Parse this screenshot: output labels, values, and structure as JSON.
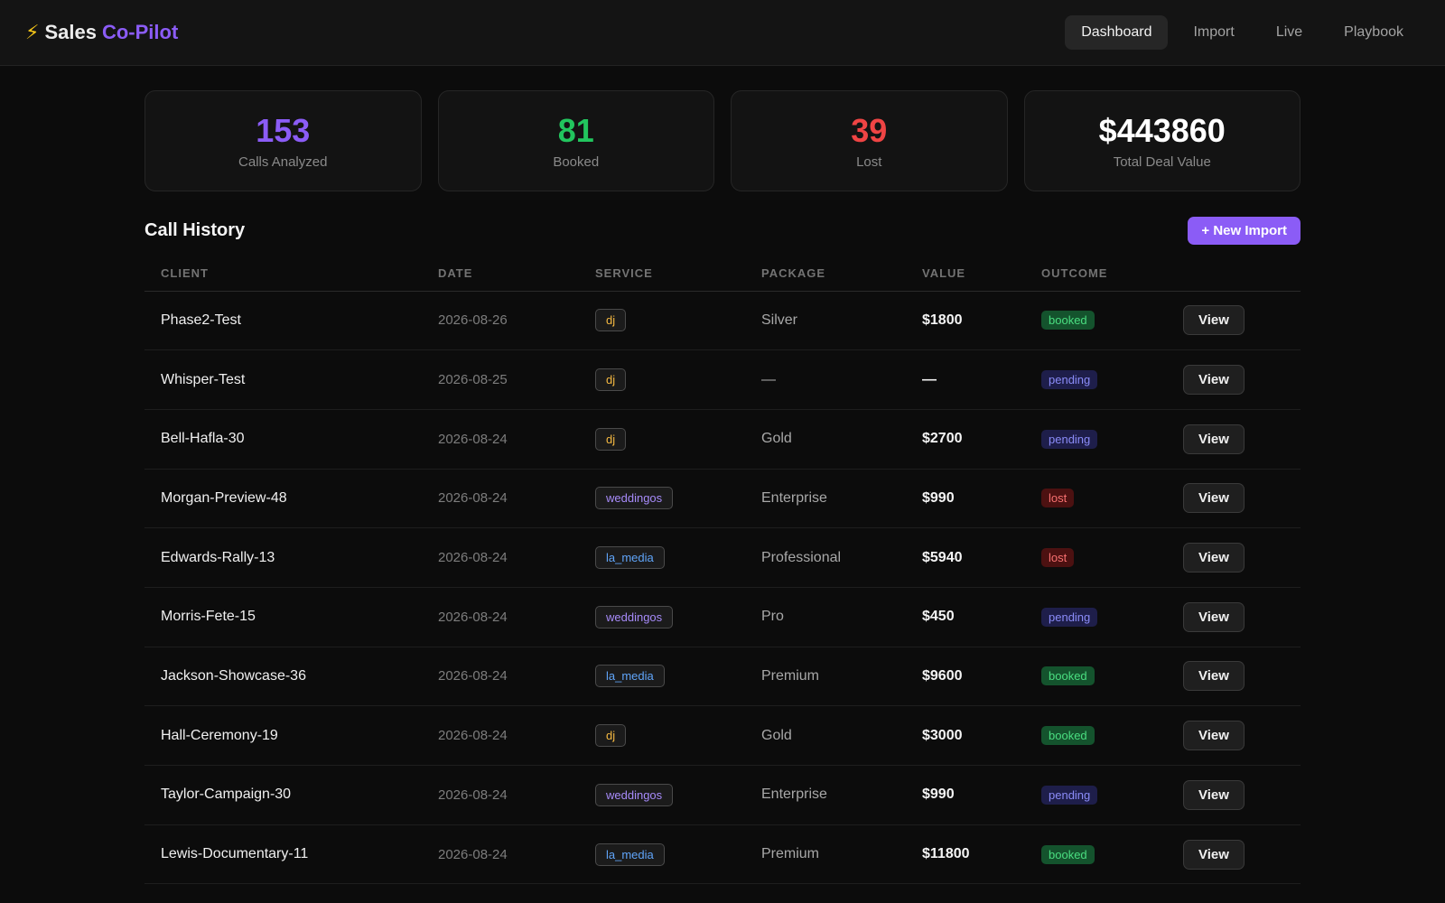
{
  "brand": {
    "icon": "lightning-bolt-icon",
    "name": "Sales",
    "accent": "Co-Pilot"
  },
  "nav": [
    {
      "label": "Dashboard",
      "active": true
    },
    {
      "label": "Import",
      "active": false
    },
    {
      "label": "Live",
      "active": false
    },
    {
      "label": "Playbook",
      "active": false
    }
  ],
  "stats": [
    {
      "value": "153",
      "label": "Calls Analyzed",
      "color": "#8b5cf6"
    },
    {
      "value": "81",
      "label": "Booked",
      "color": "#22c55e"
    },
    {
      "value": "39",
      "label": "Lost",
      "color": "#ef4444"
    },
    {
      "value": "$443860",
      "label": "Total Deal Value",
      "color": "#ffffff"
    }
  ],
  "call_history": {
    "title": "Call History",
    "new_import_label": "+ New Import",
    "columns": [
      "CLIENT",
      "DATE",
      "SERVICE",
      "PACKAGE",
      "VALUE",
      "OUTCOME",
      ""
    ],
    "view_label": "View",
    "rows": [
      {
        "client": "Phase2-Test",
        "date": "2026-08-26",
        "service": "dj",
        "package": "Silver",
        "value": "$1800",
        "outcome": "booked"
      },
      {
        "client": "Whisper-Test",
        "date": "2026-08-25",
        "service": "dj",
        "package": "—",
        "value": "—",
        "outcome": "pending"
      },
      {
        "client": "Bell-Hafla-30",
        "date": "2026-08-24",
        "service": "dj",
        "package": "Gold",
        "value": "$2700",
        "outcome": "pending"
      },
      {
        "client": "Morgan-Preview-48",
        "date": "2026-08-24",
        "service": "weddingos",
        "package": "Enterprise",
        "value": "$990",
        "outcome": "lost"
      },
      {
        "client": "Edwards-Rally-13",
        "date": "2026-08-24",
        "service": "la_media",
        "package": "Professional",
        "value": "$5940",
        "outcome": "lost"
      },
      {
        "client": "Morris-Fete-15",
        "date": "2026-08-24",
        "service": "weddingos",
        "package": "Pro",
        "value": "$450",
        "outcome": "pending"
      },
      {
        "client": "Jackson-Showcase-36",
        "date": "2026-08-24",
        "service": "la_media",
        "package": "Premium",
        "value": "$9600",
        "outcome": "booked"
      },
      {
        "client": "Hall-Ceremony-19",
        "date": "2026-08-24",
        "service": "dj",
        "package": "Gold",
        "value": "$3000",
        "outcome": "booked"
      },
      {
        "client": "Taylor-Campaign-30",
        "date": "2026-08-24",
        "service": "weddingos",
        "package": "Enterprise",
        "value": "$990",
        "outcome": "pending"
      },
      {
        "client": "Lewis-Documentary-11",
        "date": "2026-08-24",
        "service": "la_media",
        "package": "Premium",
        "value": "$11800",
        "outcome": "booked"
      }
    ]
  },
  "colors": {
    "service": {
      "dj": {
        "fg": "#f5b942",
        "border": "#4a4a4a"
      },
      "weddingos": {
        "fg": "#a78bfa",
        "border": "#4a4a4a"
      },
      "la_media": {
        "fg": "#60a5fa",
        "border": "#4a4a4a"
      }
    },
    "outcome": {
      "booked": {
        "fg": "#4ade80",
        "bg": "#14532d"
      },
      "pending": {
        "fg": "#8b8cf8",
        "bg": "#1e1e4a"
      },
      "lost": {
        "fg": "#f87171",
        "bg": "#4c1111"
      }
    }
  }
}
